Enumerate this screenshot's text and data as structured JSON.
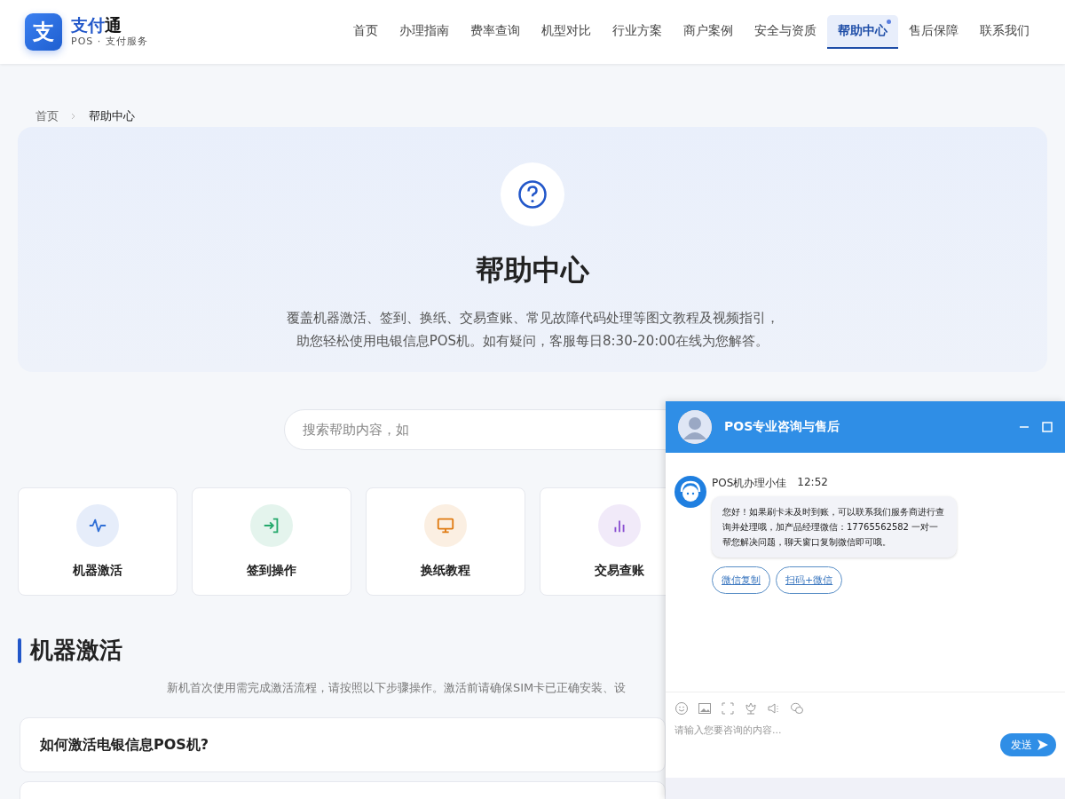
{
  "logo": {
    "mark": "支",
    "name_primary": "支付",
    "name_secondary": "通",
    "tagline": "POS · 支付服务"
  },
  "nav": [
    {
      "label": "首页",
      "selected": false,
      "dot": false
    },
    {
      "label": "办理指南",
      "selected": false,
      "dot": false
    },
    {
      "label": "费率查询",
      "selected": false,
      "dot": false
    },
    {
      "label": "机型对比",
      "selected": false,
      "dot": false
    },
    {
      "label": "行业方案",
      "selected": false,
      "dot": false
    },
    {
      "label": "商户案例",
      "selected": false,
      "dot": false
    },
    {
      "label": "安全与资质",
      "selected": false,
      "dot": false
    },
    {
      "label": "帮助中心",
      "selected": true,
      "dot": true
    },
    {
      "label": "售后保障",
      "selected": false,
      "dot": false
    },
    {
      "label": "联系我们",
      "selected": false,
      "dot": false
    }
  ],
  "breadcrumb": [
    "首页",
    "帮助中心"
  ],
  "hero": {
    "title": "帮助中心",
    "lines": [
      "覆盖机器激活、签到、换纸、交易查账、常见故障代码处理等图文教程及视频指引，",
      "助您轻松使用电银信息POS机。如有疑问，客服每日8:30-20:00在线为您解答。"
    ]
  },
  "search": {
    "placeholder": "搜索帮助内容，如"
  },
  "categories": [
    {
      "label": "机器激活",
      "kind": "pulse",
      "color": "#2f6fd6"
    },
    {
      "label": "签到操作",
      "kind": "sign-in",
      "color": "#23a86b"
    },
    {
      "label": "换纸教程",
      "kind": "monitor",
      "color": "#e07b12"
    },
    {
      "label": "交易查账",
      "kind": "chart",
      "color": "#8a4fd1"
    }
  ],
  "section": {
    "title": "机器激活",
    "description": "新机首次使用需完成激活流程，请按照以下步骤操作。激活前请确保SIM卡已正确安装、设"
  },
  "faq": [
    {
      "question": "如何激活电银信息POS机?"
    }
  ],
  "chat": {
    "title": "POS专业咨询与售后",
    "agent": "POS机办理小佳",
    "time": "12:52",
    "message": "您好！如果刷卡未及时到账，可以联系我们服务商进行查询并处理哦，加产品经理微信：17765562582 一对一帮您解决问题，聊天窗口复制微信即可哦。",
    "actions": [
      "微信复制",
      "扫码+微信"
    ],
    "placeholder": "请输入您要咨询的内容...",
    "send": "发送"
  }
}
